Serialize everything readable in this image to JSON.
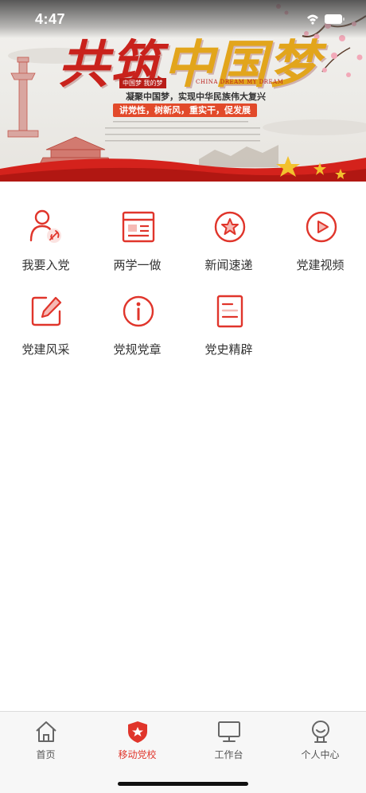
{
  "status_bar": {
    "time": "4:47"
  },
  "banner": {
    "title_part1": "共筑",
    "title_part2": "中国梦",
    "tag": "中国梦 我的梦",
    "english": "CHINA DREAM  MY DREAM",
    "subtitle": "凝聚中国梦，实现中华民族伟大复兴",
    "slogan": "讲党性，树新风，重实干，促发展"
  },
  "menu": {
    "items": [
      {
        "label": "我要入党",
        "icon": "person-party-icon"
      },
      {
        "label": "两学一做",
        "icon": "newspaper-icon"
      },
      {
        "label": "新闻速递",
        "icon": "star-circle-icon"
      },
      {
        "label": "党建视频",
        "icon": "play-circle-icon"
      },
      {
        "label": "党建风采",
        "icon": "edit-icon"
      },
      {
        "label": "党规党章",
        "icon": "info-circle-icon"
      },
      {
        "label": "党史精辟",
        "icon": "document-icon"
      }
    ]
  },
  "tabbar": {
    "tabs": [
      {
        "label": "首页",
        "icon": "home-icon"
      },
      {
        "label": "移动党校",
        "icon": "shield-star-icon",
        "active": true
      },
      {
        "label": "工作台",
        "icon": "monitor-icon"
      },
      {
        "label": "个人中心",
        "icon": "user-icon"
      }
    ]
  },
  "colors": {
    "accent": "#e0352b",
    "text": "#333333",
    "tab_inactive": "#555555"
  }
}
